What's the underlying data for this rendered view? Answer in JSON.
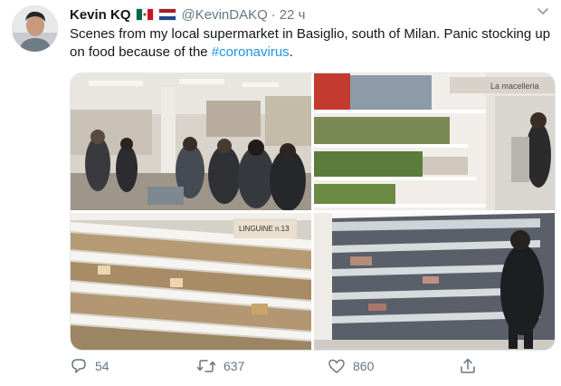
{
  "tweet": {
    "author_name": "Kevin KQ",
    "handle": "@KevinDAKQ",
    "separator": "·",
    "time": "22 ч",
    "text_before": "Scenes from my local supermarket in Basiglio, south of Milan. Panic stocking up on food because of the ",
    "hashtag": "#coronavirus",
    "text_after": ".",
    "flags": [
      "mexico-flag",
      "netherlands-flag"
    ],
    "media": [
      {
        "kind": "photo",
        "label": "crowded supermarket checkout"
      },
      {
        "kind": "photo",
        "label": "half-empty canned goods shelves"
      },
      {
        "kind": "photo",
        "label": "empty pasta shelves"
      },
      {
        "kind": "photo",
        "label": "empty refrigerated aisle"
      }
    ],
    "pasta_sign": "LINGUINE n.13",
    "store_sign": "La macelleria",
    "stats": {
      "replies": "54",
      "retweets": "637",
      "likes": "860"
    }
  },
  "colors": {
    "link": "#1b95e0",
    "secondary_text": "#657786",
    "border": "#e1e8ed"
  },
  "icons": [
    "reply-icon",
    "retweet-icon",
    "like-icon",
    "share-icon",
    "chevron-down-icon"
  ]
}
